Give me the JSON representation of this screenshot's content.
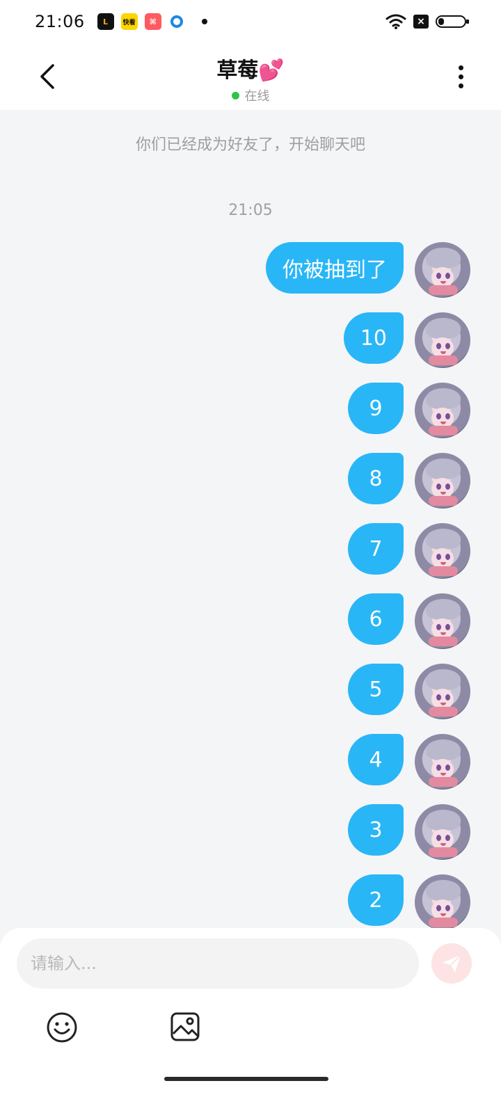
{
  "status_bar": {
    "time": "21:06",
    "apps": [
      {
        "icon": "app-orange-icon",
        "text": "L"
      },
      {
        "icon": "kuaikan-icon",
        "text": "快看"
      },
      {
        "icon": "kuaishou-icon",
        "text": "⌘"
      },
      {
        "icon": "blue-ring-icon",
        "text": ""
      }
    ],
    "wifi_icon": "wifi-icon",
    "sim_icon": "no-sim-icon",
    "sim_text": "×",
    "battery_icon": "battery-low-icon"
  },
  "header": {
    "title": "草莓💕",
    "status": "在线",
    "status_color": "#2ec44a"
  },
  "chat": {
    "system_message": "你们已经成为好友了，开始聊天吧",
    "timestamp": "21:05",
    "bubble_color": "#29b6f6",
    "messages": [
      {
        "text": "你被抽到了"
      },
      {
        "text": "10"
      },
      {
        "text": "9"
      },
      {
        "text": "8"
      },
      {
        "text": "7"
      },
      {
        "text": "6"
      },
      {
        "text": "5"
      },
      {
        "text": "4"
      },
      {
        "text": "3"
      },
      {
        "text": "2"
      }
    ]
  },
  "input": {
    "placeholder": "请输入...",
    "value": "",
    "send_color": "#fde3e3"
  },
  "toolbar": {
    "emoji_icon": "emoji-smile-icon",
    "image_icon": "image-picture-icon"
  }
}
